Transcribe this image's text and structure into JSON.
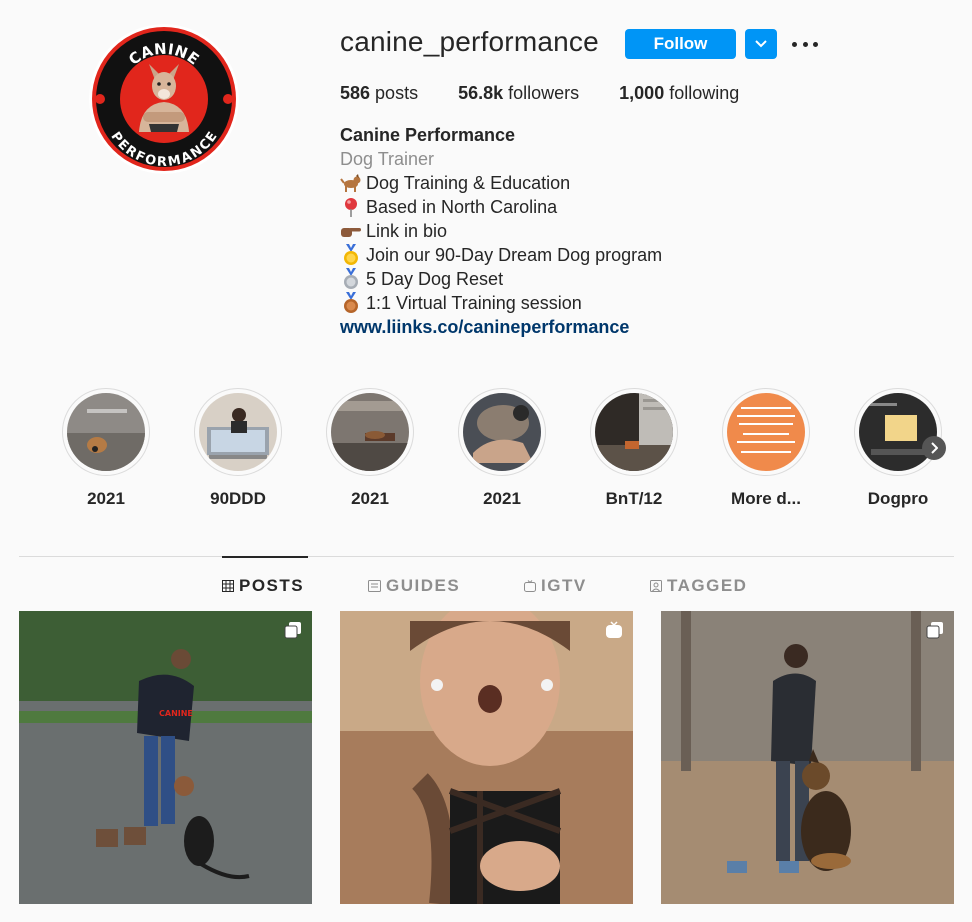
{
  "profile": {
    "username": "canine_performance",
    "follow_label": "Follow",
    "stats": {
      "posts_count": "586",
      "posts_label": " posts",
      "followers_count": "56.8k",
      "followers_label": " followers",
      "following_count": "1,000",
      "following_label": " following"
    },
    "avatar_text_top": "CANINE",
    "avatar_text_bottom": "PERFORMANCE"
  },
  "bio": {
    "name": "Canine Performance",
    "category": "Dog Trainer",
    "lines": [
      {
        "icon": "dog-icon",
        "text": "Dog Training & Education"
      },
      {
        "icon": "pin-icon",
        "text": "Based in North Carolina"
      },
      {
        "icon": "pointing-hand-icon",
        "text": "Link in bio"
      },
      {
        "icon": "gold-medal-icon",
        "text": "Join our 90-Day Dream Dog program"
      },
      {
        "icon": "silver-medal-icon",
        "text": "5 Day Dog Reset"
      },
      {
        "icon": "bronze-medal-icon",
        "text": "1:1 Virtual Training session"
      }
    ],
    "link": "www.liinks.co/canineperformance"
  },
  "highlights": [
    {
      "label": "2021"
    },
    {
      "label": "90DDD"
    },
    {
      "label": "2021"
    },
    {
      "label": "2021"
    },
    {
      "label": "BnT/12"
    },
    {
      "label": "More d..."
    },
    {
      "label": "Dogpro"
    }
  ],
  "tabs": [
    {
      "label": "POSTS",
      "icon": "grid-icon",
      "active": true
    },
    {
      "label": "GUIDES",
      "icon": "guide-icon",
      "active": false
    },
    {
      "label": "IGTV",
      "icon": "igtv-icon",
      "active": false
    },
    {
      "label": "TAGGED",
      "icon": "tagged-icon",
      "active": false
    }
  ],
  "posts": [
    {
      "badge": "carousel-icon"
    },
    {
      "badge": "igtv-icon"
    },
    {
      "badge": "carousel-icon"
    }
  ],
  "colors": {
    "follow": "#0095f6",
    "link": "#00376b",
    "brand_red": "#e1261c"
  }
}
